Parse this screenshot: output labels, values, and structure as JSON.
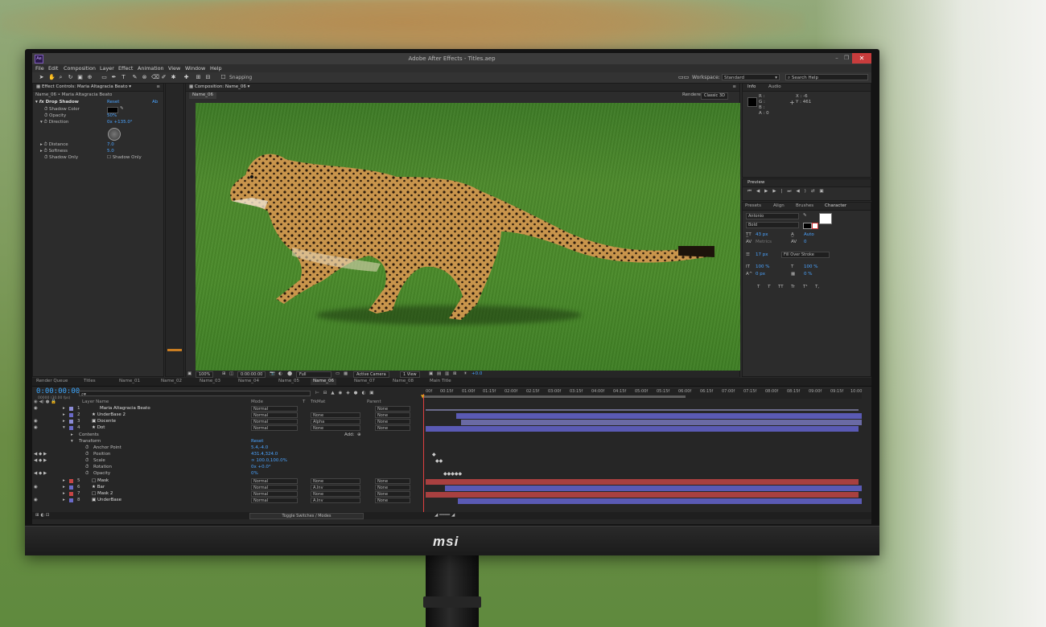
{
  "app": {
    "title": "Adobe After Effects - Titles.aep",
    "logo_text": "Ae",
    "menu": [
      "File",
      "Edit",
      "Composition",
      "Layer",
      "Effect",
      "Animation",
      "View",
      "Window",
      "Help"
    ],
    "snapping_label": "Snapping",
    "workspace_label": "Workspace:",
    "workspace_value": "Standard",
    "search_placeholder": "Search Help"
  },
  "effect_controls": {
    "tab": "Effect Controls: Maria Altagracia Beato",
    "breadcrumb": "Name_06 • Maria Altagracia Beato",
    "effect_name": "Drop Shadow",
    "reset": "Reset",
    "about": "Ab",
    "props": [
      {
        "name": "Shadow Color",
        "value": ""
      },
      {
        "name": "Opacity",
        "value": "50%"
      },
      {
        "name": "Direction",
        "value": "0x +135.0°"
      },
      {
        "name": "Distance",
        "value": "7.0"
      },
      {
        "name": "Softness",
        "value": "5.0"
      },
      {
        "name": "Shadow Only",
        "value": "Shadow Only"
      }
    ]
  },
  "composition": {
    "tab": "Composition: Name_06",
    "sub_tab": "Name_06",
    "renderer_label": "Renderer:",
    "renderer_value": "Classic 3D",
    "zoom": "100%",
    "timecode": "0:00:00:00",
    "resolution": "Full",
    "camera": "Active Camera",
    "view": "1 View",
    "exposure": "+0.0"
  },
  "info": {
    "tabs": [
      "Info",
      "Audio"
    ],
    "r": "R :",
    "g": "G :",
    "b": "B :",
    "a": "A : 0",
    "x": "X : -6",
    "y": "Y : 461"
  },
  "preview": {
    "tab": "Preview"
  },
  "character": {
    "tabs": [
      "Presets",
      "Align",
      "Brushes",
      "Character"
    ],
    "font": "Antonio",
    "style": "Bold",
    "size": "43 px",
    "leading": "Auto",
    "kerning": "Metrics",
    "tracking": "0",
    "stroke_width": "17 px",
    "stroke_mode": "Fill Over Stroke",
    "vscale": "100 %",
    "hscale": "100 %",
    "baseline": "0 px",
    "tsume": "0 %",
    "styles": [
      "T",
      "T",
      "TT",
      "Tr",
      "T¹",
      "T,"
    ]
  },
  "timeline": {
    "tabs": [
      "Render Queue",
      "Titles",
      "Name_01",
      "Name_02",
      "Name_03",
      "Name_04",
      "Name_05",
      "Name_06",
      "Name_07",
      "Name_08",
      "Main Title"
    ],
    "timecode": "0:00:00:00",
    "fps": "00000 (30.00 fps)",
    "col_layer": "Layer Name",
    "col_mode": "Mode",
    "col_t": "T",
    "col_trkmat": "TrkMat",
    "col_parent": "Parent",
    "add_label": "Add:",
    "toggle_label": "Toggle Switches / Modes",
    "ruler": [
      "00f",
      "00:15f",
      "01:00f",
      "01:15f",
      "02:00f",
      "02:15f",
      "03:00f",
      "03:15f",
      "04:00f",
      "04:15f",
      "05:00f",
      "05:15f",
      "06:00f",
      "06:15f",
      "07:00f",
      "07:15f",
      "08:00f",
      "08:15f",
      "09:00f",
      "09:15f",
      "10:00"
    ],
    "layers": [
      {
        "num": "1",
        "name": "Maria Altagracia Beato",
        "mode": "Normal",
        "trkmat": "",
        "parent": "None",
        "color": "#8c8cd6"
      },
      {
        "num": "2",
        "name": "UnderBase 2",
        "mode": "Normal",
        "trkmat": "None",
        "parent": "None",
        "color": "#6a6ac8"
      },
      {
        "num": "3",
        "name": "Docente",
        "mode": "Normal",
        "trkmat": "Alpha",
        "parent": "None",
        "color": "#8c8cd6"
      },
      {
        "num": "4",
        "name": "Dot",
        "mode": "Normal",
        "trkmat": "None",
        "parent": "None",
        "color": "#6a6ac8"
      }
    ],
    "sub_rows": [
      {
        "name": "Contents",
        "value": ""
      },
      {
        "name": "Transform",
        "value": "Reset"
      },
      {
        "name": "Anchor Point",
        "value": "5.4,-4.0"
      },
      {
        "name": "Position",
        "value": "431.4,324.0"
      },
      {
        "name": "Scale",
        "value": "100.0,100.0%"
      },
      {
        "name": "Rotation",
        "value": "0x +0.0°"
      },
      {
        "name": "Opacity",
        "value": "0%"
      }
    ],
    "layers2": [
      {
        "num": "5",
        "name": "Mask",
        "mode": "Normal",
        "trkmat": "None",
        "parent": "None",
        "color": "#c84646"
      },
      {
        "num": "6",
        "name": "Bar",
        "mode": "Normal",
        "trkmat": "A.Inv",
        "parent": "None",
        "color": "#6a6ac8"
      },
      {
        "num": "7",
        "name": "Mask 2",
        "mode": "Normal",
        "trkmat": "None",
        "parent": "None",
        "color": "#c84646"
      },
      {
        "num": "8",
        "name": "UnderBase",
        "mode": "Normal",
        "trkmat": "A.Inv",
        "parent": "None",
        "color": "#6a6ac8"
      }
    ]
  },
  "monitor": {
    "brand": "msi"
  }
}
